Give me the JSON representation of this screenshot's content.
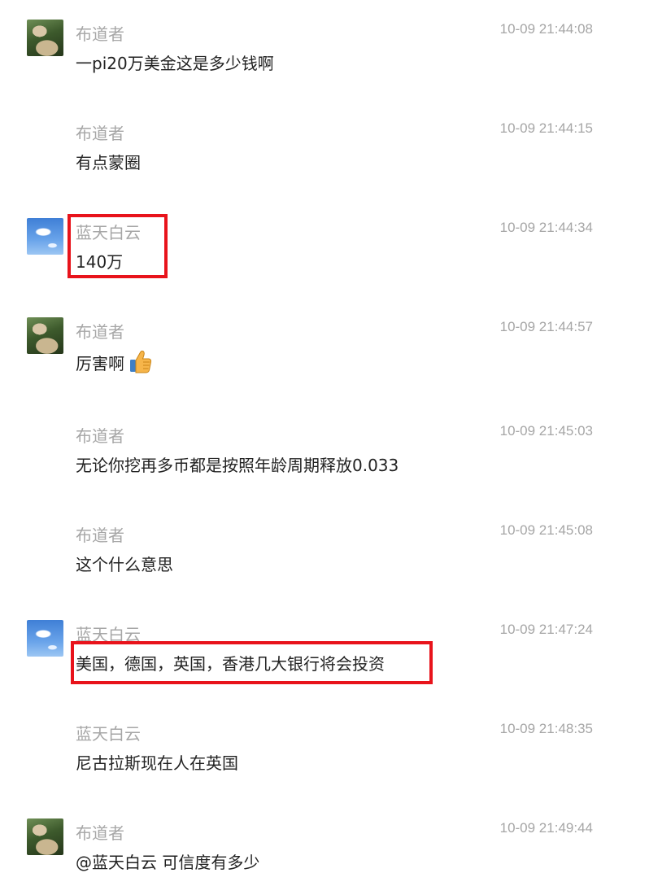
{
  "messages": [
    {
      "sender": "布道者",
      "time": "10-09 21:44:08",
      "text": "一pi20万美金这是多少钱啊",
      "avatar": "person-avatar"
    },
    {
      "sender": "布道者",
      "time": "10-09 21:44:15",
      "text": "有点蒙圈",
      "avatar": ""
    },
    {
      "sender": "蓝天白云",
      "time": "10-09 21:44:34",
      "text": "140万",
      "avatar": "sky-avatar"
    },
    {
      "sender": "布道者",
      "time": "10-09 21:44:57",
      "text": "厉害啊",
      "avatar": "person-avatar",
      "emoji": "thumbs-up-icon"
    },
    {
      "sender": "布道者",
      "time": "10-09 21:45:03",
      "text": "无论你挖再多币都是按照年龄周期释放0.033",
      "avatar": ""
    },
    {
      "sender": "布道者",
      "time": "10-09 21:45:08",
      "text": "这个什么意思",
      "avatar": ""
    },
    {
      "sender": "蓝天白云",
      "time": "10-09 21:47:24",
      "text": "美国，德国，英国，香港几大银行将会投资",
      "avatar": "sky-avatar"
    },
    {
      "sender": "蓝天白云",
      "time": "10-09 21:48:35",
      "text": "尼古拉斯现在人在英国",
      "avatar": ""
    },
    {
      "sender": "布道者",
      "time": "10-09 21:49:44",
      "text": "@蓝天白云 可信度有多少",
      "avatar": "person-avatar"
    }
  ],
  "highlight_color": "#e8131b"
}
